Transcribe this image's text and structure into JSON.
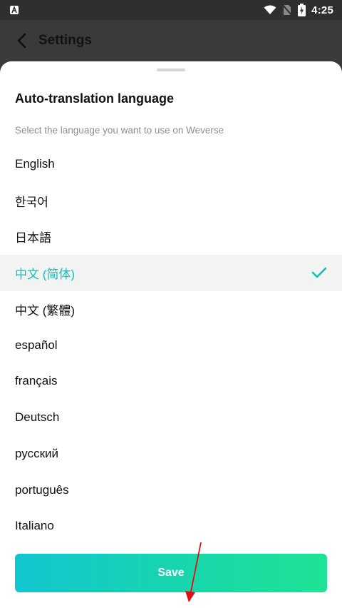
{
  "status_bar": {
    "time": "4:25",
    "icons": [
      "app-notification-icon",
      "wifi-icon",
      "no-sim-icon",
      "battery-charging-icon"
    ]
  },
  "header": {
    "title": "Settings",
    "back_icon": "chevron-left-icon"
  },
  "sheet": {
    "title": "Auto-translation language",
    "description": "Select the language you want to use on Weverse",
    "languages": [
      {
        "label": "English",
        "selected": false
      },
      {
        "label": "한국어",
        "selected": false
      },
      {
        "label": "日本語",
        "selected": false
      },
      {
        "label": "中文 (简体)",
        "selected": true
      },
      {
        "label": "中文 (繁體)",
        "selected": false
      },
      {
        "label": "español",
        "selected": false
      },
      {
        "label": "français",
        "selected": false
      },
      {
        "label": "Deutsch",
        "selected": false
      },
      {
        "label": "русский",
        "selected": false
      },
      {
        "label": "português",
        "selected": false
      },
      {
        "label": "Italiano",
        "selected": false
      }
    ],
    "save_label": "Save"
  },
  "colors": {
    "accent": "#0ec2b7",
    "save_gradient_start": "#11c6cf",
    "save_gradient_end": "#1ee394",
    "annotation_arrow": "#e01010"
  }
}
